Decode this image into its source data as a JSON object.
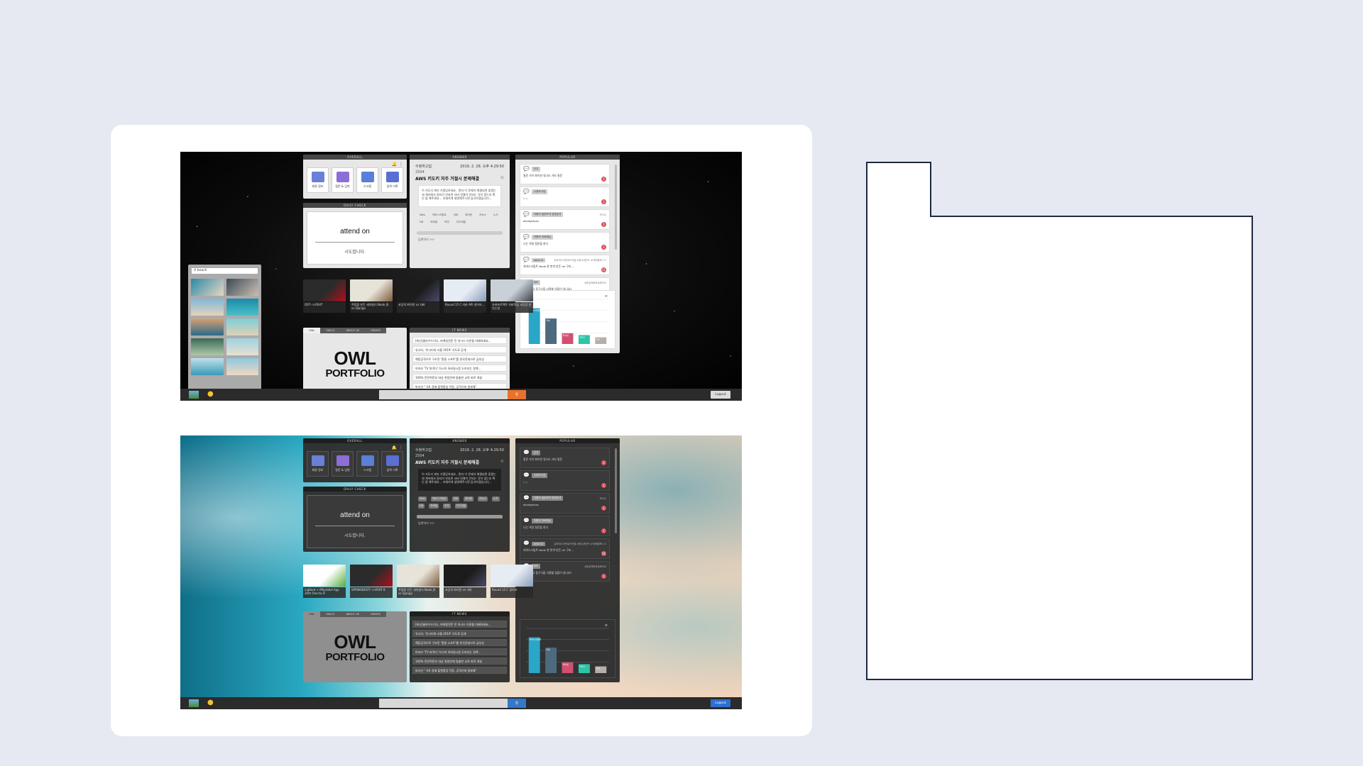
{
  "panels": {
    "overall": "OVERALL",
    "answer": "ANSWER",
    "popular": "POPULAR",
    "daily_check": "DAILY CHECK",
    "tips": "IT NEWS"
  },
  "favorites": [
    {
      "label": "회원 정보",
      "color": "#6a7fd6"
    },
    {
      "label": "질문 & 답변",
      "color": "#8d6ed6"
    },
    {
      "label": "스크랩",
      "color": "#5a7fd8"
    },
    {
      "label": "검색 기록",
      "color": "#5a6fd2"
    }
  ],
  "daily": {
    "title": "attend on",
    "sub": "시도합니다."
  },
  "answer": {
    "user": "수정하고집",
    "date": "2019. 2. 28. 오후 4:29:50",
    "id": "2504",
    "title": "AWS 키도키 자주 거절시 문제해결",
    "body": "이 키도키 계속 거절당하네요.. 뭔지 이 문제가 해결되면 좋겠는데 계속해서 정리가 안되면 서버 연결이 안되는 것이 맞는지 확인 좀 해주세요 .. 자세하게 설명해주시면 감사하겠습니다...",
    "tags": [
      "Web",
      "자바스크립트",
      "자바",
      "파이썬",
      "리눅스",
      "노드",
      "DB",
      "모바일",
      "보안",
      "자기계발"
    ],
    "link": "답변하기 >>"
  },
  "popular": [
    {
      "user": "신고",
      "side": "",
      "body": "질문 가이 파이썬 영고오 기타 질문",
      "count": "2"
    },
    {
      "user": "수정하고집",
      "side": "",
      "body": "ㄴㄴ",
      "count": "1"
    },
    {
      "user": "자평의 질문모아 영문분석",
      "side": "PCGC",
      "body": "abcdgstvas",
      "count": "1"
    },
    {
      "user": "자평의 자바해님",
      "side": "",
      "body": "나는 옥정 질문을 한다",
      "count": "1"
    },
    {
      "user": "bekim3",
      "side": "유모리스크린로드닷컴 #한수마인드 #자바컬렉 1:1",
      "body": "자바스크립트 Node 한 번씩 만든 rel 구조...",
      "count": "11"
    },
    {
      "user": "대리",
      "side": "#튜공자바보로파이오",
      "body": "java 에서 웅구식을 사용할 일을이 있나요?",
      "count": "1"
    }
  ],
  "videos_top": [
    {
      "caption": "OST-->VISAT",
      "c1": "#2b2b2b",
      "c2": "#b0101c"
    },
    {
      "caption": "쿠팡을 만든 세미빌더 Node JS vs Django",
      "c1": "#e8e3d8",
      "c2": "#7a5a3c"
    },
    {
      "caption": "코딩의 파이썬 vs 자바",
      "c1": "#1c1c1c",
      "c2": "#4a4a6a"
    },
    {
      "caption": "Round 15 C 자바 API 걸어보...",
      "c1": "#e6ecf4",
      "c2": "#8a9bb8"
    },
    {
      "caption": "자바프로젝트 자바학습 코딩강 만다는법",
      "c1": "#c9d0d8",
      "c2": "#3a4048"
    }
  ],
  "videos_bottom": [
    {
      "caption": "ingBoot + MSymbol App 20th One-to-O",
      "c1": "#ffffff",
      "c2": "#5aaa3a"
    },
    {
      "caption": "SPRINGBOOT-->VISAT 8",
      "c1": "#2b2b2b",
      "c2": "#b0101c"
    },
    {
      "caption": "쿠팡을 만든 세미빌더 Node JS vs Django",
      "c1": "#e8e3d8",
      "c2": "#7a5a3c"
    },
    {
      "caption": "코딩의 파이썬 vs 자바",
      "c1": "#1c1c1c",
      "c2": "#4a4a6a"
    },
    {
      "caption": "Round 15 C 걸어보",
      "c1": "#e6ecf4",
      "c2": "#8a9bb8"
    }
  ],
  "portfolio": {
    "tabs": [
      "OWL",
      "SKILLS",
      "ABOUT US",
      "CREATE"
    ],
    "title": "OWL",
    "sub": "PORTFOLIO"
  },
  "news": [
    "[최신]클라우드이나, 마케팅전문 전 의시드 다른을 마제하세요...",
    "유니티, '유니티와 서울 2019' 기도료 공개",
    "해킹공격으로 구조된 '탈중 소프트'를 한국전세끄로 급부상",
    "아마조 'TV 파격다' 아시아 모바일시장 도끼리는 정책...",
    "100% 전전력전부 대상 현장안에 맞춤한 교육 바로 개설",
    "파괴선 \" 4차 경제 플랫폼업 막동, 공격기회 결과채\""
  ],
  "search": {
    "label": "beach"
  },
  "taskbar": {
    "logout": "Logout"
  },
  "colors": {
    "search_btn_top": "#e8722b",
    "search_btn_bottom": "#3578c9",
    "logout_bottom": "#2d6fd1"
  },
  "chart_data": {
    "type": "bar",
    "categories": [
      "자바스크립트",
      "자바",
      "파이썬",
      "리눅스",
      "기타"
    ],
    "category_colors": [
      "#2aa6c8",
      "#4d6a7e",
      "#d24f72",
      "#2ec4a9",
      "#b8aea8"
    ],
    "values": [
      80,
      57,
      24,
      20,
      15
    ],
    "ylim": [
      0,
      100
    ],
    "grid": true
  }
}
